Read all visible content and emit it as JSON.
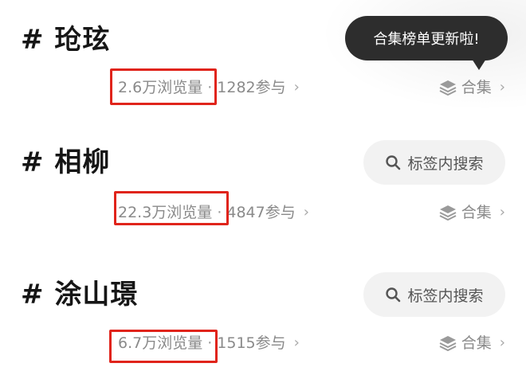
{
  "tooltip": {
    "text": "合集榜单更新啦!"
  },
  "topics": [
    {
      "title": "# 玱玹",
      "views": "2.6万浏览量",
      "separator": "·",
      "participants": "1282参与",
      "collection_label": "合集"
    },
    {
      "title": "# 相柳",
      "views": "22.3万浏览量",
      "separator": "·",
      "participants": "4847参与",
      "collection_label": "合集",
      "search_label": "标签内搜索"
    },
    {
      "title": "# 涂山璟",
      "views": "6.7万浏览量",
      "separator": "·",
      "participants": "1515参与",
      "collection_label": "合集",
      "search_label": "标签内搜索"
    }
  ],
  "icons": {
    "chevron": "›",
    "search": "search-icon",
    "collection": "layers-icon"
  },
  "colors": {
    "highlight_box": "#e0241b",
    "tooltip_bg": "#2d2d2d",
    "pill_bg": "#f2f2f2"
  }
}
